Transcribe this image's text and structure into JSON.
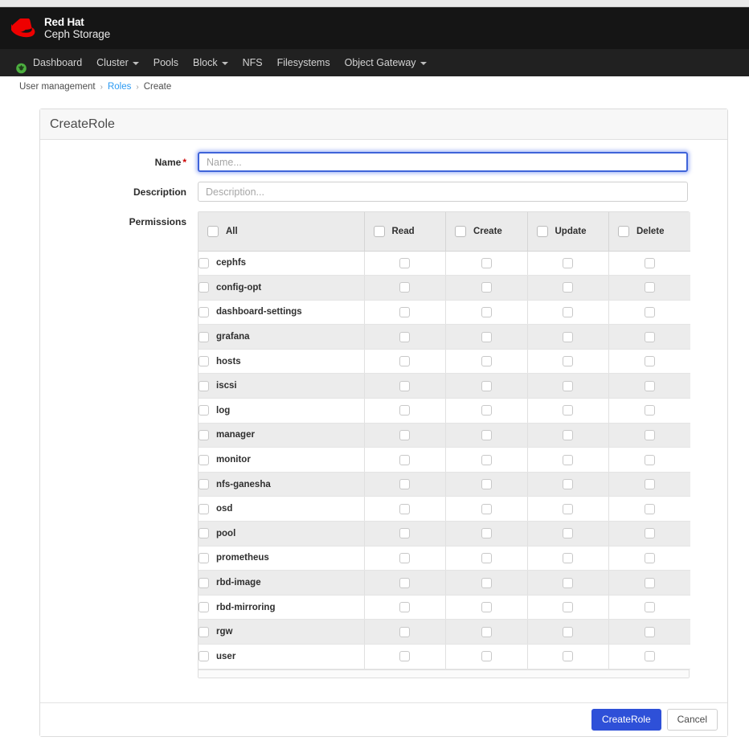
{
  "brand": {
    "line1": "Red Hat",
    "line2": "Ceph Storage",
    "logo_color": "#e00",
    "header_bg": "#151515"
  },
  "nav": {
    "items": [
      {
        "label": "Dashboard",
        "icon": "ceph-icon",
        "has_caret": false
      },
      {
        "label": "Cluster",
        "icon": null,
        "has_caret": true
      },
      {
        "label": "Pools",
        "icon": null,
        "has_caret": false
      },
      {
        "label": "Block",
        "icon": null,
        "has_caret": true
      },
      {
        "label": "NFS",
        "icon": null,
        "has_caret": false
      },
      {
        "label": "Filesystems",
        "icon": null,
        "has_caret": false
      },
      {
        "label": "Object Gateway",
        "icon": null,
        "has_caret": true
      }
    ],
    "accent": "#2b9af3"
  },
  "breadcrumb": {
    "sep": "›",
    "items": [
      {
        "label": "User management",
        "link": false
      },
      {
        "label": "Roles",
        "link": true
      },
      {
        "label": "Create",
        "link": false
      }
    ]
  },
  "card": {
    "title": "CreateRole"
  },
  "form": {
    "name": {
      "label": "Name",
      "required_mark": "*",
      "value": "",
      "placeholder": "Name...",
      "focused": true
    },
    "description": {
      "label": "Description",
      "value": "",
      "placeholder": "Description..."
    },
    "permissions": {
      "label": "Permissions"
    }
  },
  "permissions_table": {
    "columns": [
      "All",
      "Read",
      "Create",
      "Update",
      "Delete"
    ],
    "header_checked": [
      false,
      false,
      false,
      false,
      false
    ],
    "rows": [
      {
        "name": "cephfs",
        "checked": [
          false,
          false,
          false,
          false,
          false
        ]
      },
      {
        "name": "config-opt",
        "checked": [
          false,
          false,
          false,
          false,
          false
        ]
      },
      {
        "name": "dashboard-settings",
        "checked": [
          false,
          false,
          false,
          false,
          false
        ]
      },
      {
        "name": "grafana",
        "checked": [
          false,
          false,
          false,
          false,
          false
        ]
      },
      {
        "name": "hosts",
        "checked": [
          false,
          false,
          false,
          false,
          false
        ]
      },
      {
        "name": "iscsi",
        "checked": [
          false,
          false,
          false,
          false,
          false
        ]
      },
      {
        "name": "log",
        "checked": [
          false,
          false,
          false,
          false,
          false
        ]
      },
      {
        "name": "manager",
        "checked": [
          false,
          false,
          false,
          false,
          false
        ]
      },
      {
        "name": "monitor",
        "checked": [
          false,
          false,
          false,
          false,
          false
        ]
      },
      {
        "name": "nfs-ganesha",
        "checked": [
          false,
          false,
          false,
          false,
          false
        ]
      },
      {
        "name": "osd",
        "checked": [
          false,
          false,
          false,
          false,
          false
        ]
      },
      {
        "name": "pool",
        "checked": [
          false,
          false,
          false,
          false,
          false
        ]
      },
      {
        "name": "prometheus",
        "checked": [
          false,
          false,
          false,
          false,
          false
        ]
      },
      {
        "name": "rbd-image",
        "checked": [
          false,
          false,
          false,
          false,
          false
        ]
      },
      {
        "name": "rbd-mirroring",
        "checked": [
          false,
          false,
          false,
          false,
          false
        ]
      },
      {
        "name": "rgw",
        "checked": [
          false,
          false,
          false,
          false,
          false
        ]
      },
      {
        "name": "user",
        "checked": [
          false,
          false,
          false,
          false,
          false
        ]
      }
    ]
  },
  "footer": {
    "submit_label": "CreateRole",
    "cancel_label": "Cancel",
    "primary_color": "#2e50d8"
  }
}
